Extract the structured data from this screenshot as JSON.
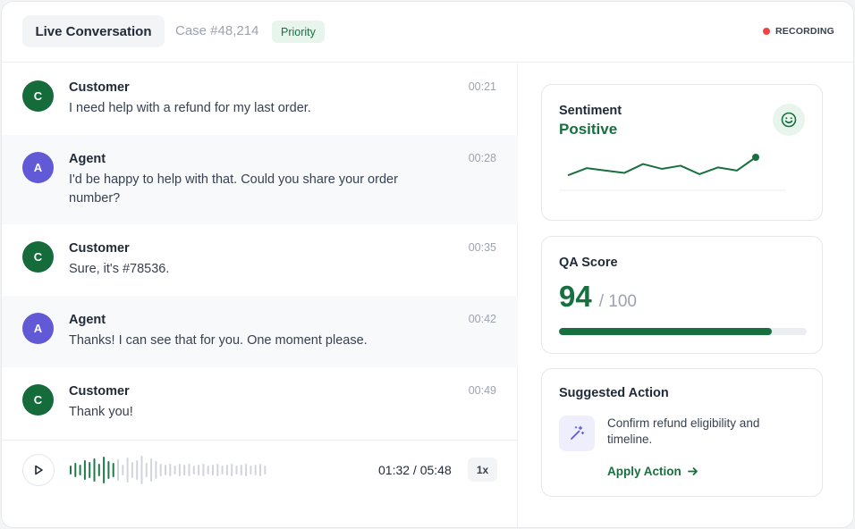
{
  "header": {
    "tab_label": "Live Conversation",
    "case_label": "Case #48,214",
    "priority_label": "Priority",
    "recording_label": "RECORDING"
  },
  "messages": [
    {
      "role": "customer",
      "initial": "C",
      "sender": "Customer",
      "text": "I need help with a refund for my last order.",
      "time": "00:21"
    },
    {
      "role": "agent",
      "initial": "A",
      "sender": "Agent",
      "text": "I'd be happy to help with that. Could you share your order number?",
      "time": "00:28"
    },
    {
      "role": "customer",
      "initial": "C",
      "sender": "Customer",
      "text": "Sure, it's #78536.",
      "time": "00:35"
    },
    {
      "role": "agent",
      "initial": "A",
      "sender": "Agent",
      "text": "Thanks! I can see that for you. One moment please.",
      "time": "00:42"
    },
    {
      "role": "customer",
      "initial": "C",
      "sender": "Customer",
      "text": "Thank you!",
      "time": "00:49"
    }
  ],
  "audio": {
    "play_icon": "play-icon",
    "current_time": "01:32",
    "duration": "05:48",
    "time_display": "01:32 / 05:48",
    "progress": 0.264,
    "speed_label": "1x"
  },
  "sentiment": {
    "title": "Sentiment",
    "value": "Positive",
    "icon": "smiley-icon",
    "trend": [
      0.25,
      0.55,
      0.45,
      0.35,
      0.72,
      0.52,
      0.65,
      0.3,
      0.58,
      0.45,
      1.0
    ]
  },
  "qa": {
    "title": "QA Score",
    "score": "94",
    "total": "/ 100",
    "fraction": 0.86
  },
  "suggested": {
    "title": "Suggested Action",
    "icon": "magic-wand-icon",
    "text": "Confirm refund eligibility and timeline.",
    "action_label": "Apply Action"
  },
  "colors": {
    "brand_green": "#16703f",
    "agent_purple": "#6159d6",
    "recording_red": "#ef4444",
    "wave_played": "#1f7a4a",
    "wave_unplayed": "#d1d5db"
  }
}
